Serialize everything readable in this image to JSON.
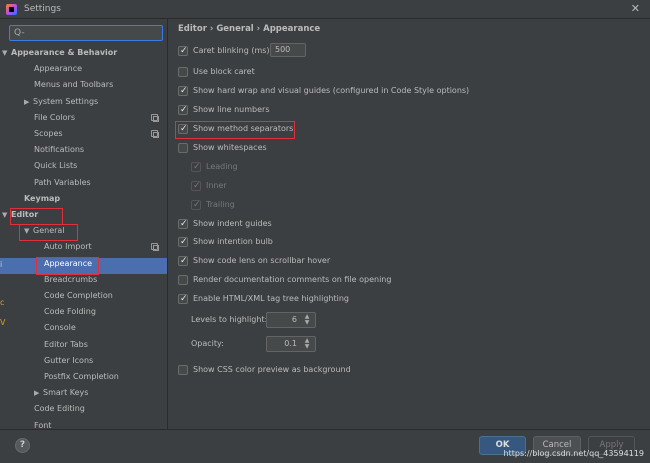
{
  "window": {
    "title": "Settings",
    "close_glyph": "✕"
  },
  "search": {
    "placeholder": "Q-"
  },
  "tree": [
    {
      "label": "Appearance & Behavior",
      "bold": true,
      "arrow": "▼"
    },
    {
      "label": "Appearance"
    },
    {
      "label": "Menus and Toolbars"
    },
    {
      "label": "System Settings",
      "arrow": "▶"
    },
    {
      "label": "File Colors",
      "copy": true
    },
    {
      "label": "Scopes",
      "copy": true
    },
    {
      "label": "Notifications"
    },
    {
      "label": "Quick Lists"
    },
    {
      "label": "Path Variables"
    },
    {
      "label": "Keymap",
      "bold": true
    },
    {
      "label": "Editor",
      "bold": true,
      "arrow": "▼"
    },
    {
      "label": "General",
      "arrow": "▼"
    },
    {
      "label": "Auto Import",
      "copy": true
    },
    {
      "label": "Appearance",
      "selected": true
    },
    {
      "label": "Breadcrumbs"
    },
    {
      "label": "Code Completion"
    },
    {
      "label": "Code Folding"
    },
    {
      "label": "Console"
    },
    {
      "label": "Editor Tabs"
    },
    {
      "label": "Gutter Icons"
    },
    {
      "label": "Postfix Completion"
    },
    {
      "label": "Smart Keys",
      "arrow": "▶"
    },
    {
      "label": "Code Editing"
    },
    {
      "label": "Font"
    }
  ],
  "edge_chars": [
    "i",
    "c",
    "V"
  ],
  "breadcrumb": "Editor  ›  General  ›  Appearance",
  "options": [
    {
      "label": "Caret blinking (ms):",
      "checked": true
    },
    {
      "label": "Use block caret",
      "checked": false
    },
    {
      "label": "Show hard wrap and visual guides (configured in Code Style options)",
      "checked": true
    },
    {
      "label": "Show line numbers",
      "checked": true
    },
    {
      "label": "Show method separators",
      "checked": true,
      "highlighted": true
    },
    {
      "label": "Show whitespaces",
      "checked": false
    },
    {
      "label": "Leading",
      "checked": true,
      "disabled": true,
      "indent": 1
    },
    {
      "label": "Inner",
      "checked": true,
      "disabled": true,
      "indent": 1
    },
    {
      "label": "Trailing",
      "checked": true,
      "disabled": true,
      "indent": 1
    },
    {
      "label": "Show indent guides",
      "checked": true
    },
    {
      "label": "Show intention bulb",
      "checked": true
    },
    {
      "label": "Show code lens on scrollbar hover",
      "checked": true
    },
    {
      "label": "Render documentation comments on file opening",
      "checked": false
    },
    {
      "label": "Enable HTML/XML tag tree highlighting",
      "checked": true
    },
    {
      "label": "Show CSS color preview as background",
      "checked": false
    }
  ],
  "caret_blinking_value": "500",
  "levels": {
    "label": "Levels to highlight:",
    "value": "6"
  },
  "opacity": {
    "label": "Opacity:",
    "value": "0.1"
  },
  "buttons": {
    "ok": "OK",
    "cancel": "Cancel",
    "apply": "Apply",
    "help": "?"
  },
  "watermark": "https://blog.csdn.net/qq_43594119",
  "colors": {
    "accent": "#4b6eaf",
    "highlight_box": "#e0303a",
    "ok_button": "#365880"
  }
}
